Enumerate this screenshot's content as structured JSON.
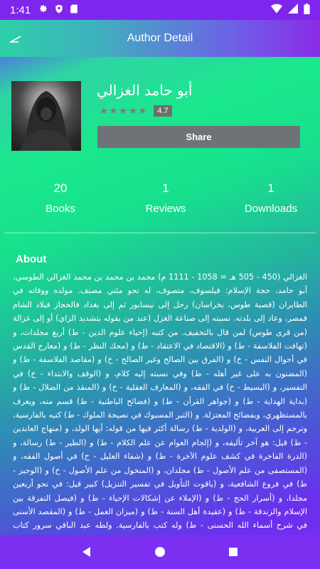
{
  "status_bar": {
    "time": "1:41",
    "icons": [
      "gear-icon",
      "shield-icon",
      "sd-card-icon",
      "wifi-icon",
      "signal-icon",
      "battery-icon"
    ]
  },
  "app_bar": {
    "title": "Author Detail",
    "back_icon": "back-arrow-icon"
  },
  "author": {
    "name": "أبو حامد الغزالي",
    "rating_value": "4.7",
    "stars_count": 5,
    "share_label": "Share"
  },
  "stats": {
    "books_count": "20",
    "books_label": "Books",
    "reviews_count": "1",
    "reviews_label": "Reviews",
    "downloads_count": "1",
    "downloads_label": "Downloads"
  },
  "about": {
    "title": "About",
    "text": "الغزالي (450 - 505 هـ = 1058 - 1111 م) محمد بن محمد بن محمد الغزالي الطوسي، أبو حامد، حجة الإسلام: فيلسوف، متصوف، له نحو مئتي مصنف. مولده ووفاته في الطابران (قصبة طوس، بخراسان) رحل إلى نيسابور ثم إلى بغداد فالحجاز فبلاد الشام فمصر، وعاد إلى بلدته. نسبته إلى صناعة الغزل (عند من يقوله بتشديد الزاي) أو إلى غزالة (من قرى طوس) لمن قال بالتخفيف. من كتبه (إحياء علوم الدين - ط) أربع مجلدات، و (تهافت الفلاسفة - ط) و (الاقتصاد في الاعتقاد - ط) و (محك النظر - ط) و (معارج القدس في أحوال النفس - خ) و (الفرق بين الصالح وغير الصالح - خ) و (مقاصد الفلاسفة - ط) و (المضنون به على غير أهله - ط) وفي نسبته إليه كلام، و (الوقف والابتداء - خ) في التفسير، و (البسيط - خ) في الفقه، و (المعارف العقلية - خ) و (المنقذ من الضلال - ط) و (بداية الهداية - ط) و (جواهر القرآن - ط) و (فضائح الباطنية - ط) قسم منه، ويعرف بالمستظهري، وبفضائح المعتزلة. و (التبر المسبوك في نصيحة الملوك - ط) كتبه بالفارسية، وترجم إلى العربية، و (الولدية - ط) رسالة أكثر فيها من قوله: أيها الولد، و (منهاج العابدين - ط) قيل: هو آخر تأليفه، و (إلجام العوام عن علم الكلام - ط) و (الطير - ط) رسالة، و (الدرة الفاخرة في كشف علوم الآخرة - ط) و (شفاء العليل - خ) في أصول الفقه، و (المستصفى من علم الأصول - ط) مجلدان، و (المنخول من علم الأصول - خ) و (الوجيز - ط) في فروع الشافعية، و (ياقوت التأويل في تفسير التنزيل) كبير قيل: في نحو أربعين مجلدا، و (أسرار الحج - ط) و (الإملاء عن إشكالات الإحياء - ط) و (فيصل التفرقة بين الإسلام والزندقة - ط) و (عقيدة أهل السنة - ط) و (ميزان العمل - ط) و (المقصد الأسنى في شرح أسماء الله الحسنى - ط) وله كتب بالفارسية. ولطه عبد الباقي سرور كتاب (الغزالي - ط) في سيرته، ومثله ليوحنا قمير، ولجميل صليبا وكامل عياد، ولمحمد رضا ولزكي مبارك (الأخلاق عند الغزالي - ط)"
  },
  "nav_bar": {
    "icons": [
      "back-triangle-icon",
      "home-circle-icon",
      "recents-square-icon"
    ]
  },
  "colors": {
    "status_bar": "#7f26ee",
    "share_button": "#6f7378",
    "nav_bar": "#7b2ff0"
  }
}
